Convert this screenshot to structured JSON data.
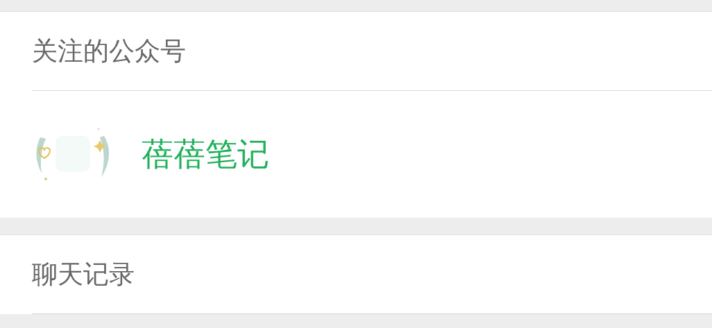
{
  "sections": [
    {
      "title": "关注的公众号",
      "items": [
        {
          "name": "蓓蓓笔记"
        }
      ]
    },
    {
      "title": "聊天记录"
    }
  ]
}
